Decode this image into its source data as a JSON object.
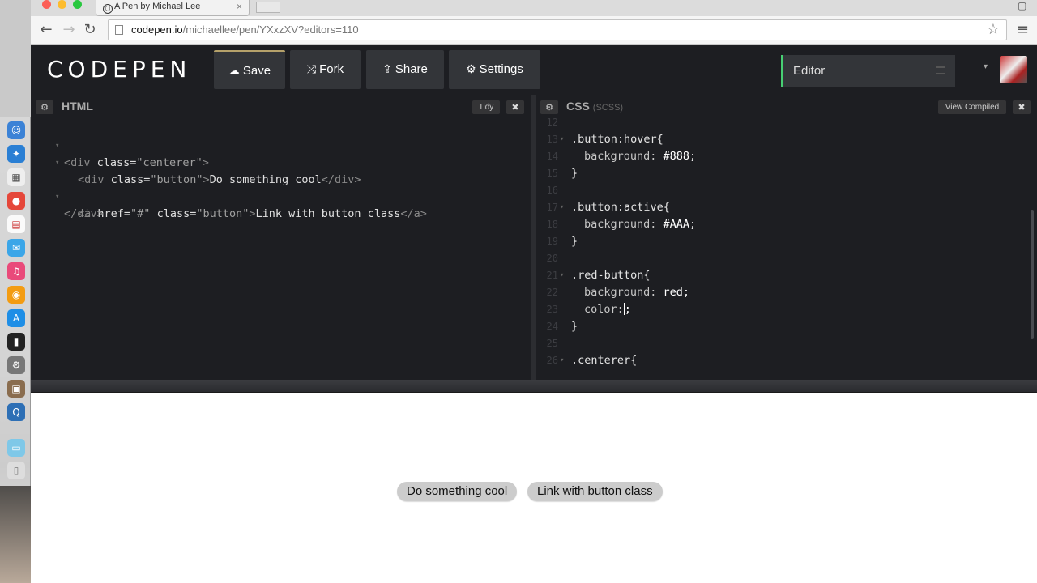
{
  "browser": {
    "tab_title": "A Pen by Michael Lee",
    "tab_close": "×",
    "url_host": "codepen.io",
    "url_path": "/michaellee/pen/YXxzXV?editors=110",
    "back": "←",
    "forward": "→",
    "reload": "↻",
    "star": "☆",
    "menu": "≡"
  },
  "header": {
    "logo": "CODEPEN",
    "buttons": [
      {
        "icon": "☁",
        "label": "Save"
      },
      {
        "icon": "⤮",
        "label": "Fork"
      },
      {
        "icon": "⇪",
        "label": "Share"
      },
      {
        "icon": "⚙",
        "label": "Settings"
      }
    ],
    "view_label": "Editor",
    "caret": "▾"
  },
  "html_editor": {
    "title": "HTML",
    "gear": "⚙",
    "tidy": "Tidy",
    "close": "✖"
  },
  "css_editor": {
    "title": "CSS",
    "preprocessor": "(SCSS)",
    "gear": "⚙",
    "view_compiled": "View Compiled",
    "close": "✖"
  },
  "html_code": {
    "l1_open": "<div",
    "l1_attr": " class=",
    "l1_val": "\"centerer\"",
    "l1_close": ">",
    "l2_open": "<div",
    "l2_attr": " class=",
    "l2_val": "\"button\"",
    "l2_close": ">",
    "l2_text": "Do something cool",
    "l2_end": "</div>",
    "l4_open": "<a",
    "l4_attr1": " href=",
    "l4_val1": "\"#\"",
    "l4_attr2": " class=",
    "l4_val2": "\"button\"",
    "l4_close": ">",
    "l4_text": "Link with button class",
    "l4_end": "</a>",
    "l5_end": "</div>"
  },
  "css_code": {
    "lines": [
      {
        "n": "12",
        "sel": "",
        "prop": "",
        "val": "",
        "fold": false
      },
      {
        "n": "13",
        "sel": ".button:hover{",
        "prop": "",
        "val": "",
        "fold": true
      },
      {
        "n": "14",
        "sel": "",
        "prop": "background:",
        "val": " #888;",
        "fold": false
      },
      {
        "n": "15",
        "sel": "}",
        "prop": "",
        "val": "",
        "fold": false
      },
      {
        "n": "16",
        "sel": "",
        "prop": "",
        "val": "",
        "fold": false
      },
      {
        "n": "17",
        "sel": ".button:active{",
        "prop": "",
        "val": "",
        "fold": true
      },
      {
        "n": "18",
        "sel": "",
        "prop": "background:",
        "val": " #AAA;",
        "fold": false
      },
      {
        "n": "19",
        "sel": "}",
        "prop": "",
        "val": "",
        "fold": false
      },
      {
        "n": "20",
        "sel": "",
        "prop": "",
        "val": "",
        "fold": false
      },
      {
        "n": "21",
        "sel": ".red-button{",
        "prop": "",
        "val": "",
        "fold": true
      },
      {
        "n": "22",
        "sel": "",
        "prop": "background:",
        "val": " red;",
        "fold": false
      },
      {
        "n": "23",
        "sel": "",
        "prop": "color:",
        "val": ";",
        "fold": false,
        "cursor": true
      },
      {
        "n": "24",
        "sel": "}",
        "prop": "",
        "val": "",
        "fold": false
      },
      {
        "n": "25",
        "sel": "",
        "prop": "",
        "val": "",
        "fold": false
      },
      {
        "n": "26",
        "sel": ".centerer{",
        "prop": "",
        "val": "",
        "fold": true
      }
    ]
  },
  "preview": {
    "button1": "Do something cool",
    "button2": "Link with button class"
  },
  "colors": {
    "editor_bg": "#1d1e22",
    "view_accent": "#47cf73",
    "save_accent": "#b5a16a"
  }
}
